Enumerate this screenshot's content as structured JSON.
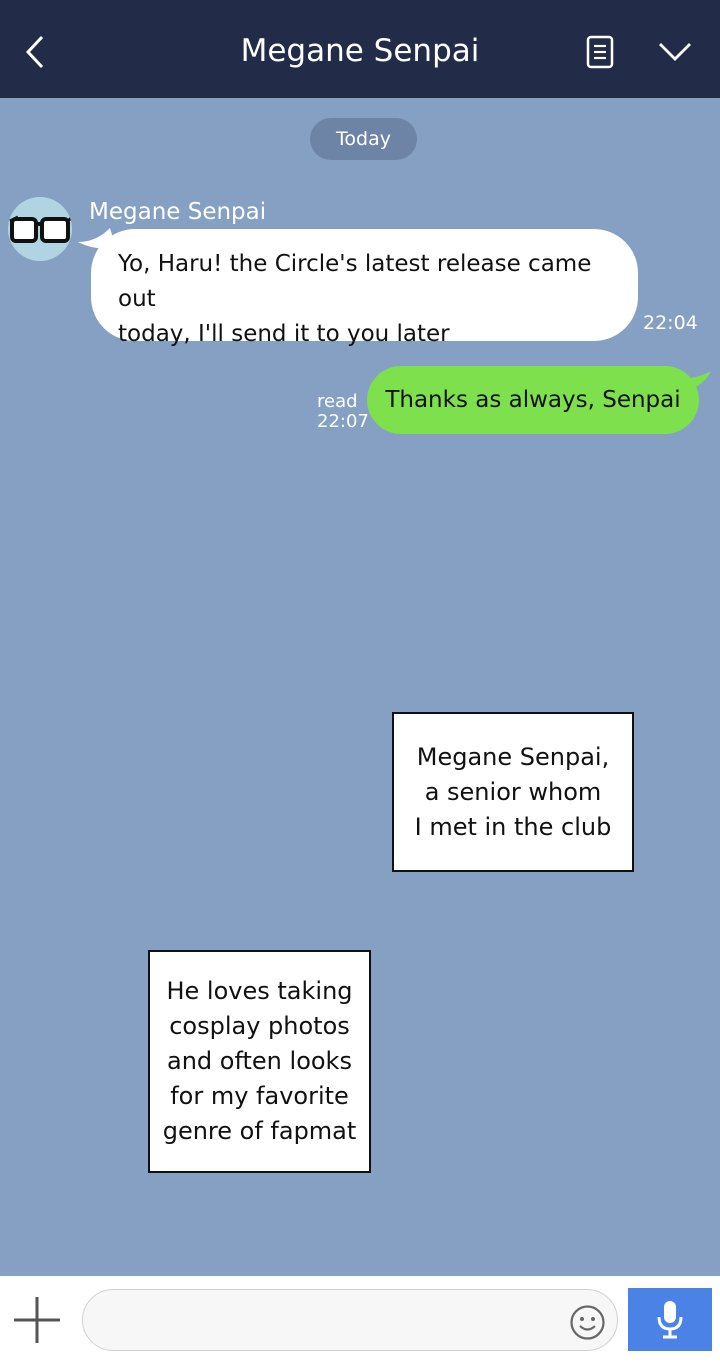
{
  "header": {
    "title": "Megane Senpai",
    "back_icon": "chevron-left-icon",
    "menu_icon": "note-icon",
    "expand_icon": "chevron-down-icon",
    "background": "#222c48"
  },
  "chat": {
    "background": "#85a0c3",
    "date_label": "Today",
    "messages": [
      {
        "direction": "incoming",
        "sender": "Megane Senpai",
        "avatar_icon": "glasses-icon",
        "lines": [
          "Yo, Haru! the Circle's latest release came out",
          "today, I'll send it to you later"
        ],
        "time": "22:04"
      },
      {
        "direction": "outgoing",
        "text": "Thanks as always, Senpai",
        "status": "read",
        "time": "22:07",
        "bubble_color": "#7ee04d"
      }
    ]
  },
  "captions": [
    {
      "text": "Megane Senpai,\na senior whom\nI met in the club"
    },
    {
      "text": "He loves taking\ncosplay photos\nand often looks\nfor my favorite\ngenre of fapmat"
    }
  ],
  "input_bar": {
    "value": "",
    "placeholder": "",
    "plus_icon": "plus-icon",
    "emoji_icon": "smiley-icon",
    "mic_icon": "microphone-icon",
    "mic_color": "#4b82e6"
  }
}
